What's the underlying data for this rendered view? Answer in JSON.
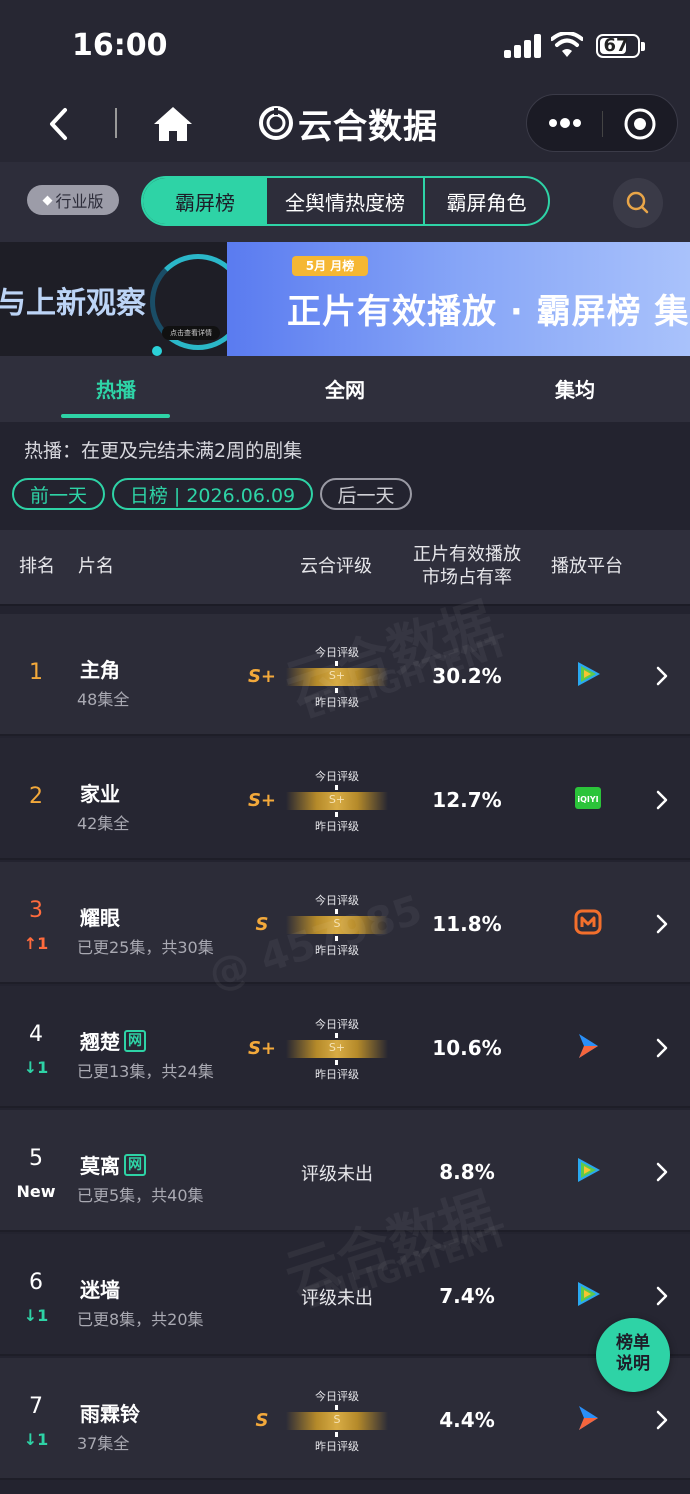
{
  "status_bar": {
    "time": "16:00",
    "battery": "67"
  },
  "nav": {
    "app_name": "云合数据"
  },
  "switcher": {
    "edition_badge": "行业版",
    "tabs": [
      "霸屏榜",
      "全舆情热度榜",
      "霸屏角色"
    ],
    "active_tab": "霸屏榜"
  },
  "banner": {
    "left_text": "与上新观察",
    "left_cta": "点击查看详情",
    "month_tag": "5月 月榜",
    "title": "正片有效播放 · 霸屏榜 集"
  },
  "category_tabs": [
    "热播",
    "全网",
    "集均"
  ],
  "description": "热播：在更及完结未满2周的剧集",
  "date_nav": {
    "prev": "前一天",
    "current": "日榜 | 2026.06.09",
    "next": "后一天"
  },
  "table": {
    "headers": {
      "rank": "排名",
      "title": "片名",
      "grade": "云合评级",
      "share_line1": "正片有效播放",
      "share_line2": "市场占有率",
      "platform": "播放平台"
    },
    "gauge_today": "今日评级",
    "gauge_yesterday": "昨日评级",
    "rows": [
      {
        "rank": "1",
        "change": "",
        "title": "主角",
        "badge": "",
        "sub": "48集全",
        "grade": "S+",
        "today_grade": "S+",
        "share": "30.2%",
        "platform": "tencent-video-icon"
      },
      {
        "rank": "2",
        "change": "",
        "title": "家业",
        "badge": "",
        "sub": "42集全",
        "grade": "S+",
        "today_grade": "S+",
        "share": "12.7%",
        "platform": "iqiyi-icon"
      },
      {
        "rank": "3",
        "change": "↑1",
        "title": "耀眼",
        "badge": "",
        "sub": "已更25集，共30集",
        "grade": "S",
        "today_grade": "S",
        "share": "11.8%",
        "platform": "mango-tv-icon"
      },
      {
        "rank": "4",
        "change": "↓1",
        "title": "翘楚",
        "badge": "网",
        "sub": "已更13集，共24集",
        "grade": "S+",
        "today_grade": "S+",
        "share": "10.6%",
        "platform": "youku-icon"
      },
      {
        "rank": "5",
        "change": "New",
        "title": "莫离",
        "badge": "网",
        "sub": "已更5集，共40集",
        "grade": "",
        "no_grade": "评级未出",
        "share": "8.8%",
        "platform": "tencent-video-icon"
      },
      {
        "rank": "6",
        "change": "↓1",
        "title": "迷墙",
        "badge": "",
        "sub": "已更8集，共20集",
        "grade": "",
        "no_grade": "评级未出",
        "share": "7.4%",
        "platform": "tencent-video-icon"
      },
      {
        "rank": "7",
        "change": "↓1",
        "title": "雨霖铃",
        "badge": "",
        "sub": "37集全",
        "grade": "S",
        "today_grade": "S",
        "share": "4.4%",
        "platform": "youku-icon"
      }
    ]
  },
  "float_button": {
    "line1": "榜单",
    "line2": "说明"
  },
  "watermarks": [
    "云合数据",
    "ENLIGHTENT",
    "@ 457985"
  ],
  "colors": {
    "accent": "#2ed3a6",
    "grade": "#f3a93b",
    "up": "#ff6b3d",
    "down": "#2ed3a6"
  }
}
